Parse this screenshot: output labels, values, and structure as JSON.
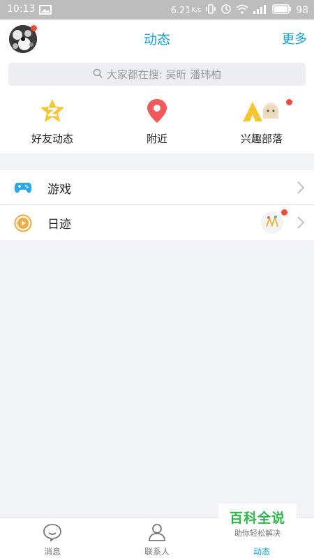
{
  "status_bar": {
    "time": "10:13",
    "speed": "6.21",
    "speed_unit": "K/s",
    "battery": "98"
  },
  "header": {
    "title": "动态",
    "more": "更多"
  },
  "search": {
    "placeholder": "大家都在搜: 吴昕 潘玮柏"
  },
  "quick_nav": [
    {
      "label": "好友动态",
      "icon": "star-z-icon"
    },
    {
      "label": "附近",
      "icon": "location-pin-icon"
    },
    {
      "label": "兴趣部落",
      "icon": "tent-icon"
    }
  ],
  "list": [
    {
      "label": "游戏",
      "icon": "gamepad-icon"
    },
    {
      "label": "日迹",
      "icon": "play-circle-icon"
    }
  ],
  "tabs": [
    {
      "label": "消息",
      "icon": "chat-bubble-icon"
    },
    {
      "label": "联系人",
      "icon": "person-icon"
    },
    {
      "label": "动态",
      "icon": "star-icon"
    }
  ],
  "watermark": {
    "title": "百科全说",
    "subtitle": "助你轻松解决"
  },
  "colors": {
    "accent": "#15a0de",
    "badge": "#f24b3d",
    "status_bar": "#bdbdbd"
  }
}
